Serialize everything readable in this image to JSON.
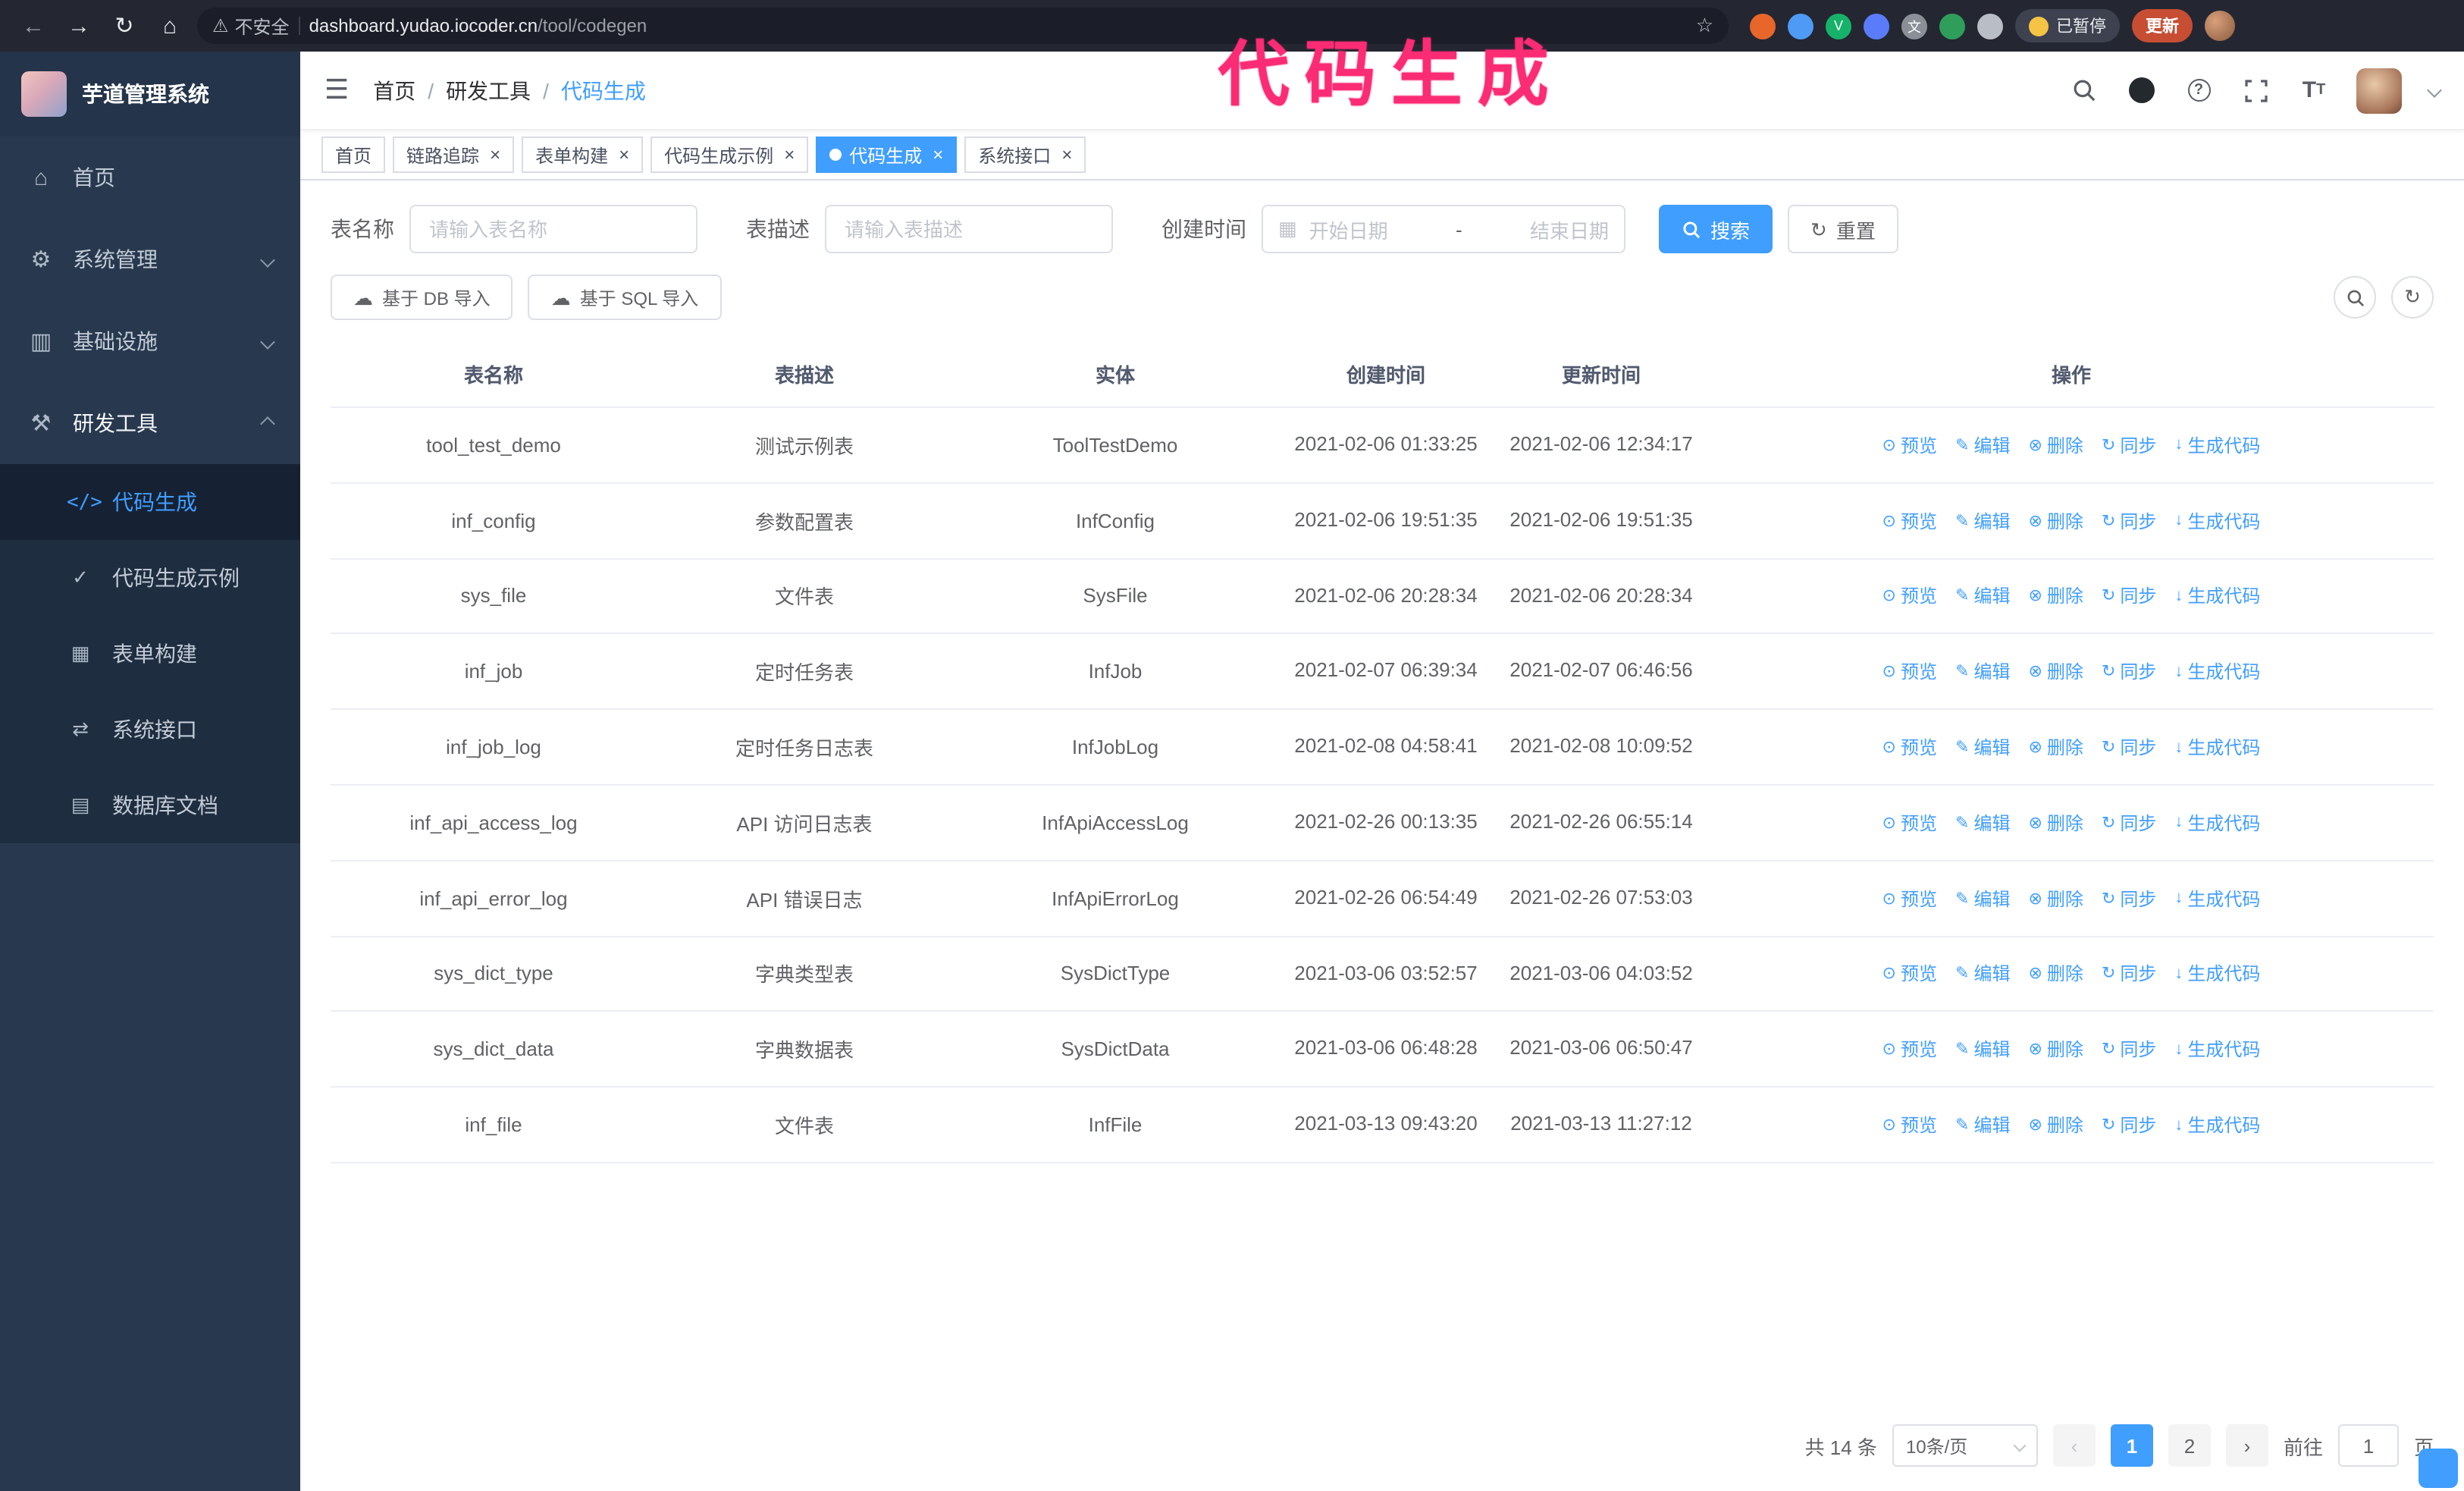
{
  "browser": {
    "warning_text": "不安全",
    "url_domain": "dashboard.yudao.iocoder.cn",
    "url_path": "/tool/codegen",
    "paused_badge": "已暂停",
    "update_button": "更新"
  },
  "annotation": "代码生成",
  "icons": {
    "back": "←",
    "forward": "→",
    "reload": "↻",
    "chrome_home": "⌂",
    "warning": "⚠",
    "star": "☆",
    "ext_v": "V",
    "ext_translate": "文",
    "hamburger": "☰",
    "home": "⌂",
    "gear": "⚙",
    "infra": "▥",
    "tools": "⚒",
    "code": "</>",
    "example": "✓",
    "form": "▦",
    "api": "⇄",
    "dbdoc": "▤",
    "help": "?",
    "font_large": "T",
    "font_small": "T",
    "close": "×",
    "calendar": "▦",
    "cloud": "☁",
    "refresh": "↻",
    "preview": "⊙",
    "edit": "✎",
    "delete": "⊗",
    "sync": "↻",
    "generate": "↓",
    "prev": "‹",
    "next": "›"
  },
  "sidebar": {
    "logo_title": "芋道管理系统",
    "items": [
      {
        "label": "首页"
      },
      {
        "label": "系统管理"
      },
      {
        "label": "基础设施"
      },
      {
        "label": "研发工具"
      }
    ],
    "sub_items": [
      {
        "label": "代码生成"
      },
      {
        "label": "代码生成示例"
      },
      {
        "label": "表单构建"
      },
      {
        "label": "系统接口"
      },
      {
        "label": "数据库文档"
      }
    ]
  },
  "header": {
    "breadcrumb": [
      "首页",
      "研发工具",
      "代码生成"
    ]
  },
  "tabs": [
    {
      "label": "首页"
    },
    {
      "label": "链路追踪"
    },
    {
      "label": "表单构建"
    },
    {
      "label": "代码生成示例"
    },
    {
      "label": "代码生成"
    },
    {
      "label": "系统接口"
    }
  ],
  "filters": {
    "table_name_label": "表名称",
    "table_name_placeholder": "请输入表名称",
    "table_desc_label": "表描述",
    "table_desc_placeholder": "请输入表描述",
    "create_time_label": "创建时间",
    "start_date_placeholder": "开始日期",
    "date_separator": "-",
    "end_date_placeholder": "结束日期",
    "search_button": "搜索",
    "reset_button": "重置"
  },
  "toolbar": {
    "import_db_button": "基于 DB 导入",
    "import_sql_button": "基于 SQL 导入"
  },
  "table": {
    "columns": [
      "表名称",
      "表描述",
      "实体",
      "创建时间",
      "更新时间",
      "操作"
    ],
    "actions": [
      "预览",
      "编辑",
      "删除",
      "同步",
      "生成代码"
    ],
    "rows": [
      {
        "name": "tool_test_demo",
        "desc": "测试示例表",
        "entity": "ToolTestDemo",
        "created": "2021-02-06 01:33:25",
        "updated": "2021-02-06 12:34:17"
      },
      {
        "name": "inf_config",
        "desc": "参数配置表",
        "entity": "InfConfig",
        "created": "2021-02-06 19:51:35",
        "updated": "2021-02-06 19:51:35"
      },
      {
        "name": "sys_file",
        "desc": "文件表",
        "entity": "SysFile",
        "created": "2021-02-06 20:28:34",
        "updated": "2021-02-06 20:28:34"
      },
      {
        "name": "inf_job",
        "desc": "定时任务表",
        "entity": "InfJob",
        "created": "2021-02-07 06:39:34",
        "updated": "2021-02-07 06:46:56"
      },
      {
        "name": "inf_job_log",
        "desc": "定时任务日志表",
        "entity": "InfJobLog",
        "created": "2021-02-08 04:58:41",
        "updated": "2021-02-08 10:09:52"
      },
      {
        "name": "inf_api_access_log",
        "desc": "API 访问日志表",
        "entity": "InfApiAccessLog",
        "created": "2021-02-26 00:13:35",
        "updated": "2021-02-26 06:55:14"
      },
      {
        "name": "inf_api_error_log",
        "desc": "API 错误日志",
        "entity": "InfApiErrorLog",
        "created": "2021-02-26 06:54:49",
        "updated": "2021-02-26 07:53:03"
      },
      {
        "name": "sys_dict_type",
        "desc": "字典类型表",
        "entity": "SysDictType",
        "created": "2021-03-06 03:52:57",
        "updated": "2021-03-06 04:03:52"
      },
      {
        "name": "sys_dict_data",
        "desc": "字典数据表",
        "entity": "SysDictData",
        "created": "2021-03-06 06:48:28",
        "updated": "2021-03-06 06:50:47"
      },
      {
        "name": "inf_file",
        "desc": "文件表",
        "entity": "InfFile",
        "created": "2021-03-13 09:43:20",
        "updated": "2021-03-13 11:27:12"
      }
    ]
  },
  "pagination": {
    "total_text": "共 14 条",
    "page_size_text": "10条/页",
    "pages": [
      "1",
      "2"
    ],
    "goto_label": "前往",
    "goto_value": "1",
    "page_unit": "页"
  },
  "colors": {
    "accent": "#409eff",
    "annotation": "#fb2b74",
    "sidebar_bg": "#28394f",
    "submenu_bg": "#1f2d40"
  }
}
